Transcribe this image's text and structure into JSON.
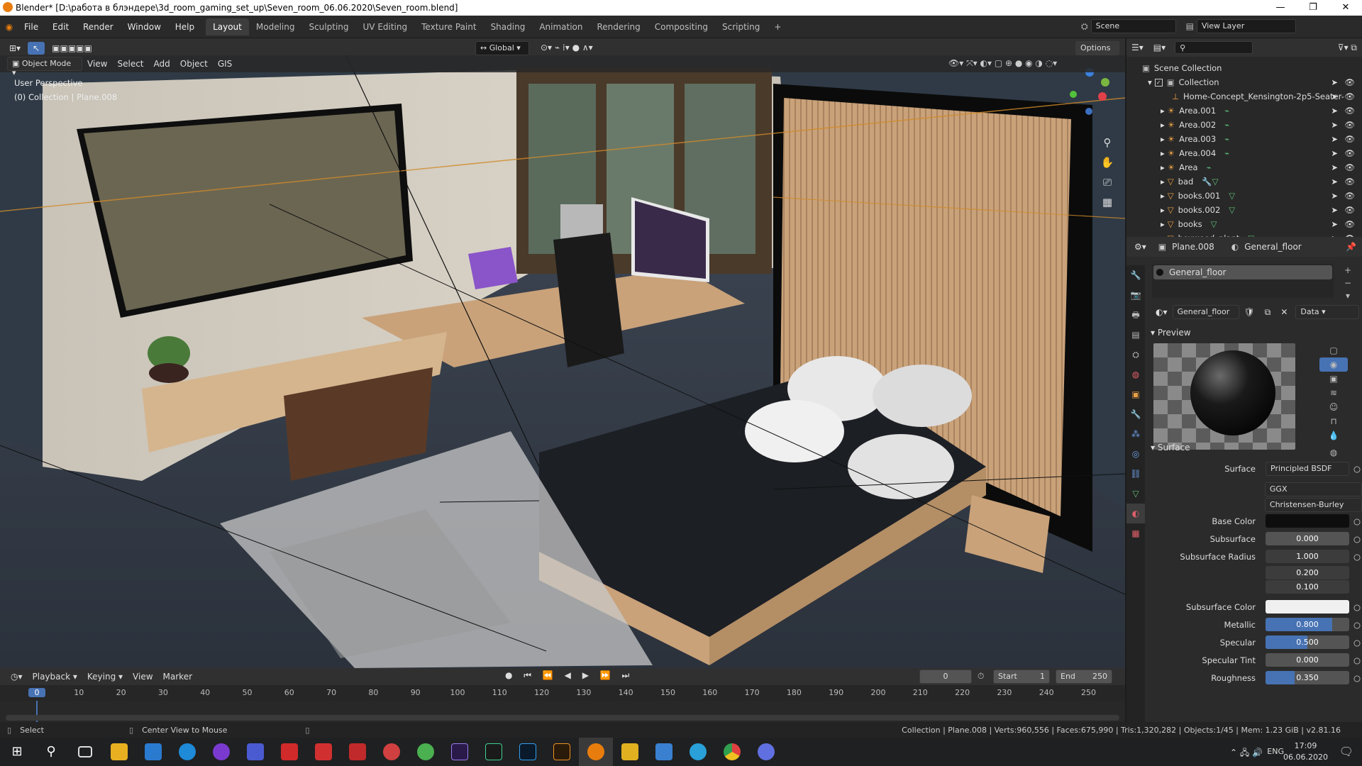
{
  "window": {
    "title": "Blender* [D:\\работа в блэндере\\3d_room_gaming_set_up\\Seven_room_06.06.2020\\Seven_room.blend]"
  },
  "menu": [
    "File",
    "Edit",
    "Render",
    "Window",
    "Help"
  ],
  "workspaces": [
    "Layout",
    "Modeling",
    "Sculpting",
    "UV Editing",
    "Texture Paint",
    "Shading",
    "Animation",
    "Rendering",
    "Compositing",
    "Scripting"
  ],
  "scene": {
    "name": "Scene",
    "view_layer": "View Layer"
  },
  "viewport": {
    "transform": "Global",
    "options": "Options",
    "mode": "Object Mode",
    "header_menu": [
      "View",
      "Select",
      "Add",
      "Object",
      "GIS"
    ],
    "overlay_title": "User Perspective",
    "overlay_sub": "(0) Collection | Plane.008"
  },
  "outliner": {
    "root": "Scene Collection",
    "collection": "Collection",
    "items": [
      "Home-Concept_Kensington-2p5-Seater-",
      "Area.001",
      "Area.002",
      "Area.003",
      "Area.004",
      "Area",
      "bad",
      "books.001",
      "books.002",
      "books",
      "boxwood_plant"
    ]
  },
  "properties": {
    "object": "Plane.008",
    "material": "General_floor",
    "slot": "General_floor",
    "data_mode": "Data",
    "preview_label": "Preview",
    "surface_label": "Surface",
    "surface_shader_label": "Surface",
    "surface_shader": "Principled BSDF",
    "distribution": "GGX",
    "subsurface_method": "Christensen-Burley",
    "base_color_label": "Base Color",
    "base_color": "#0e0e0e",
    "subsurface_color": "#f0f0f0",
    "rows": {
      "subsurface": {
        "label": "Subsurface",
        "value": "0.000",
        "fill": 0
      },
      "radius_label": "Subsurface Radius",
      "radius": [
        "1.000",
        "0.200",
        "0.100"
      ],
      "subsurface_color_label": "Subsurface Color",
      "metallic": {
        "label": "Metallic",
        "value": "0.800",
        "fill": 0.8
      },
      "specular": {
        "label": "Specular",
        "value": "0.500",
        "fill": 0.5
      },
      "specular_tint": {
        "label": "Specular Tint",
        "value": "0.000",
        "fill": 0
      },
      "roughness": {
        "label": "Roughness",
        "value": "0.350",
        "fill": 0.35
      }
    }
  },
  "timeline": {
    "menus": [
      "Playback",
      "Keying",
      "View",
      "Marker"
    ],
    "current": "0",
    "start_label": "Start",
    "start": "1",
    "end_label": "End",
    "end": "250",
    "ticks": [
      "0",
      "10",
      "20",
      "30",
      "40",
      "50",
      "60",
      "70",
      "80",
      "90",
      "100",
      "110",
      "120",
      "130",
      "140",
      "150",
      "160",
      "170",
      "180",
      "190",
      "200",
      "210",
      "220",
      "230",
      "240",
      "250"
    ]
  },
  "status": {
    "select": "Select",
    "center": "Center View to Mouse",
    "stats": "Collection | Plane.008 | Verts:960,556 | Faces:675,990 | Tris:1,320,282 | Objects:1/45 | Mem: 1.23 GiB | v2.81.16"
  },
  "taskbar": {
    "lang": "ENG",
    "time": "17:09",
    "date": "06.06.2020"
  },
  "colors": {
    "accent": "#4772b3",
    "active_tab": "#3d3d3d",
    "orange_line": "#d08a2a"
  }
}
